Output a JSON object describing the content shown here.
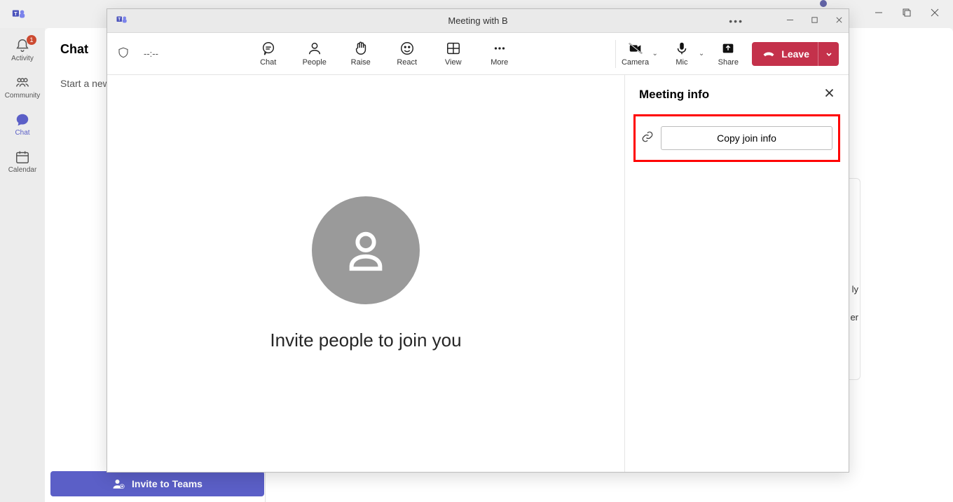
{
  "sidebar": {
    "items": [
      {
        "label": "Activity",
        "badge": "1"
      },
      {
        "label": "Community"
      },
      {
        "label": "Chat"
      },
      {
        "label": "Calendar"
      }
    ]
  },
  "chat_panel": {
    "title": "Chat",
    "body_text": "Start a new"
  },
  "invite_button": {
    "label": "Invite to Teams"
  },
  "meeting": {
    "title": "Meeting with B",
    "timer": "--:--",
    "toolbar": {
      "chat": "Chat",
      "people": "People",
      "raise": "Raise",
      "react": "React",
      "view": "View",
      "more": "More",
      "camera": "Camera",
      "mic": "Mic",
      "share": "Share"
    },
    "leave_label": "Leave",
    "stage_text": "Invite people to join you",
    "panel": {
      "title": "Meeting info",
      "copy_label": "Copy join info"
    }
  },
  "bg_peek": {
    "line1": "ly",
    "line2": "er"
  }
}
